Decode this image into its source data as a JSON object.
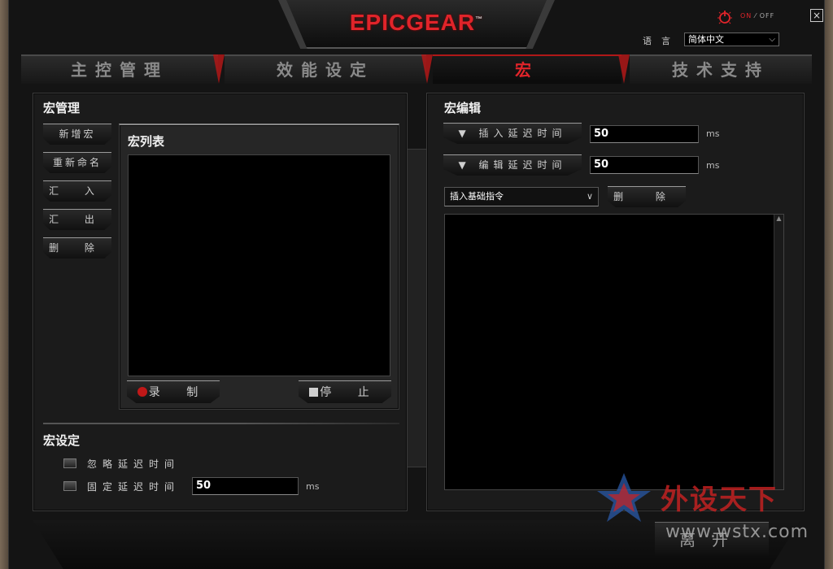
{
  "app": {
    "logo": "EPICGEAR",
    "tm": "™"
  },
  "power": {
    "on": "ON",
    "sep": " ⁄ ",
    "off": "OFF"
  },
  "window": {
    "close": "×"
  },
  "language": {
    "label": "语言",
    "selected": "简体中文"
  },
  "tabs": [
    {
      "label": "主控管理",
      "active": false
    },
    {
      "label": "效能设定",
      "active": false
    },
    {
      "label": "宏",
      "active": true
    },
    {
      "label": "技术支持",
      "active": false
    }
  ],
  "macro_manage": {
    "title": "宏管理",
    "buttons": {
      "new": "新增宏",
      "rename": "重新命名",
      "import": "汇 入",
      "export": "汇 出",
      "delete": "删 除"
    },
    "list_title": "宏列表",
    "record": "录 制",
    "stop": "停 止"
  },
  "macro_settings": {
    "title": "宏设定",
    "ignore_delay": "忽略延迟时间",
    "fixed_delay": "固定延迟时间",
    "fixed_delay_value": "50",
    "unit": "ms"
  },
  "macro_edit": {
    "title": "宏编辑",
    "insert_delay_label": "▼ 插入延迟时间",
    "insert_delay_value": "50",
    "edit_delay_label": "▼ 编辑延迟时间",
    "edit_delay_value": "50",
    "unit": "ms",
    "command_select": "插入基础指令",
    "delete": "删 除"
  },
  "footer": {
    "leave": "离开"
  },
  "watermark": {
    "brand": "外设天下",
    "url": "www.wstx.com"
  },
  "colors": {
    "accent": "#e0242a",
    "panel": "#1b1b1b",
    "bg": "#101010"
  }
}
